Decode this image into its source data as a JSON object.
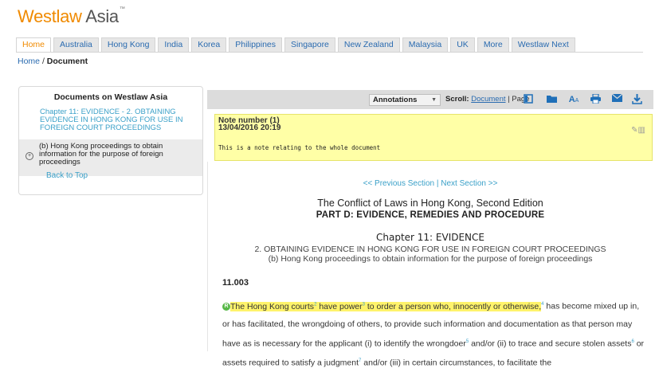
{
  "brand": {
    "logo_w": "Westlaw",
    "logo_asia": "Asia",
    "tm": "™"
  },
  "tabs": [
    {
      "label": "Home",
      "active": true
    },
    {
      "label": "Australia"
    },
    {
      "label": "Hong Kong"
    },
    {
      "label": "India"
    },
    {
      "label": "Korea"
    },
    {
      "label": "Philippines"
    },
    {
      "label": "Singapore"
    },
    {
      "label": "New Zealand"
    },
    {
      "label": "Malaysia"
    },
    {
      "label": "UK"
    },
    {
      "label": "More"
    },
    {
      "label": "Westlaw Next"
    }
  ],
  "breadcrumb": {
    "home": "Home",
    "sep": "/",
    "current": "Document"
  },
  "left_panel": {
    "title": "Documents on Westlaw Asia",
    "chapter": "Chapter 11: EVIDENCE - 2. OBTAINING EVIDENCE IN HONG KONG FOR USE IN FOREIGN COURT PROCEEDINGS",
    "selected": "(b) Hong Kong proceedings to obtain information for the purpose of foreign proceedings",
    "back": "Back to Top"
  },
  "toolbar": {
    "annotations": "Annotations",
    "scroll_label": "Scroll:",
    "scroll_document": "Document",
    "scroll_sep": "|",
    "scroll_page": "Page"
  },
  "note": {
    "number": "Note number (1)",
    "date": "13/04/2016 20:19",
    "body": "This is a note relating to the whole document"
  },
  "doc": {
    "prev": "<< Previous Section",
    "sep": "|",
    "next": "Next Section >>",
    "book_title": "The Conflict of Laws in Hong Kong, Second Edition",
    "part": "PART D: EVIDENCE, REMEDIES AND PROCEDURE",
    "chapter": "Chapter 11: EVIDENCE",
    "sub1": "2. OBTAINING EVIDENCE IN HONG KONG FOR USE IN FOREIGN COURT PROCEEDINGS",
    "sub2": "(b) Hong Kong proceedings to obtain information for the purpose of foreign proceedings",
    "para_no": "11.003",
    "p_hl1": "The Hong Kong courts",
    "fn2": "2",
    "p_hl2": " have power",
    "fn3": "3",
    "p_hl3": " to order a person who, innocently or otherwise,",
    "fn4": "4",
    "p_rest1": " has become mixed up in, or has facilitated, the wrongdoing of others, to provide such information and documentation as that person may have as is necessary for the applicant (i) to identify the wrongdoer",
    "fn5": "5",
    "p_rest2": " and/or (ii) to trace and secure stolen assets",
    "fn6": "6",
    "p_rest3": " or assets required to satisfy a judgment",
    "fn7": "7",
    "p_rest4": " and/or (iii) in certain circumstances, to facilitate the"
  },
  "colors": {
    "accent": "#f08a00",
    "link": "#2a6bb0",
    "note_bg": "#ffffa6",
    "highlight": "#fff36b"
  }
}
